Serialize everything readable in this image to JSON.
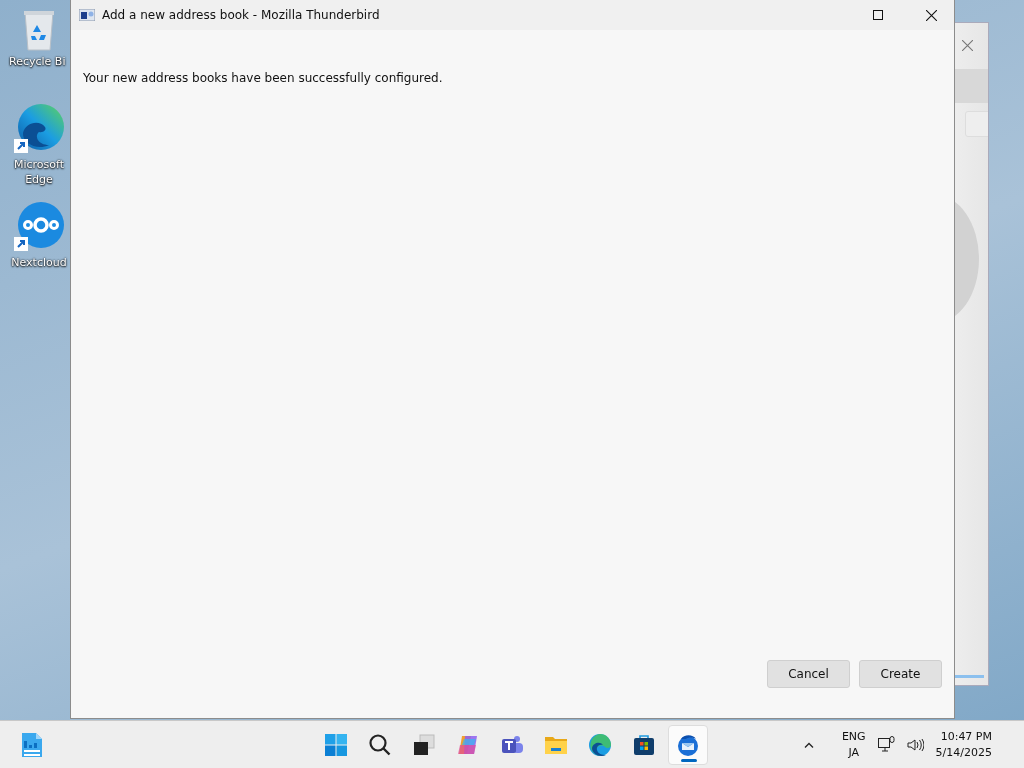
{
  "desktop_icons": [
    {
      "kind": "recycle-bin",
      "label": "Recycle Bi"
    },
    {
      "kind": "edge",
      "label": "Microsoft Edge"
    },
    {
      "kind": "nextcloud",
      "label": "Nextcloud"
    }
  ],
  "window": {
    "title": "Add a new address book - Mozilla Thunderbird",
    "message": "Your new address books have been successfully configured.",
    "buttons": [
      "Cancel",
      "Create"
    ]
  },
  "taskbar": {
    "apps": [
      {
        "kind": "start",
        "selected": false
      },
      {
        "kind": "search",
        "selected": false
      },
      {
        "kind": "task-view",
        "selected": false
      },
      {
        "kind": "copilot",
        "selected": false
      },
      {
        "kind": "teams",
        "selected": false
      },
      {
        "kind": "file-explorer",
        "selected": false
      },
      {
        "kind": "edge",
        "selected": false
      },
      {
        "kind": "store",
        "selected": false
      },
      {
        "kind": "thunderbird",
        "selected": true
      }
    ],
    "language": "ENG",
    "input_mode": "JA",
    "time": "10:47 PM",
    "date": "5/14/2025"
  }
}
